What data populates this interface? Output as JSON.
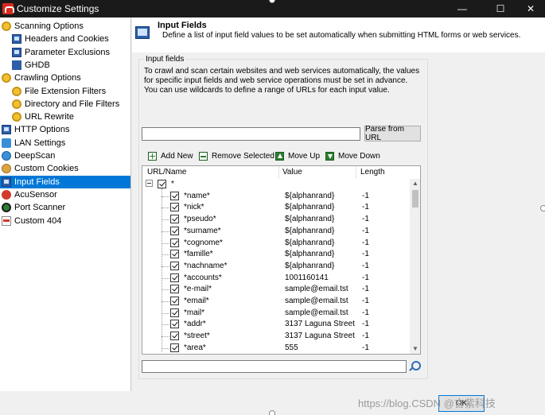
{
  "window": {
    "title": "Customize Settings",
    "minimize": "—",
    "maximize": "☐",
    "close": "✕"
  },
  "tree": [
    {
      "label": "Scanning Options",
      "icon": "gear-icon",
      "level": 0,
      "selected": false
    },
    {
      "label": "Headers and Cookies",
      "icon": "monitor-icon",
      "level": 1,
      "selected": false
    },
    {
      "label": "Parameter Exclusions",
      "icon": "monitor-icon",
      "level": 1,
      "selected": false
    },
    {
      "label": "GHDB",
      "icon": "ghdb-icon",
      "level": 1,
      "selected": false
    },
    {
      "label": "Crawling Options",
      "icon": "gear-icon",
      "level": 0,
      "selected": false
    },
    {
      "label": "File Extension Filters",
      "icon": "gear-icon",
      "level": 1,
      "selected": false
    },
    {
      "label": "Directory and File Filters",
      "icon": "gear-icon",
      "level": 1,
      "selected": false
    },
    {
      "label": "URL Rewrite",
      "icon": "gear-icon",
      "level": 1,
      "selected": false
    },
    {
      "label": "HTTP Options",
      "icon": "monitor-icon",
      "level": 0,
      "selected": false
    },
    {
      "label": "LAN Settings",
      "icon": "lan-icon",
      "level": 0,
      "selected": false
    },
    {
      "label": "DeepScan",
      "icon": "globe-icon",
      "level": 0,
      "selected": false
    },
    {
      "label": "Custom Cookies",
      "icon": "cookie-icon",
      "level": 0,
      "selected": false
    },
    {
      "label": "Input Fields",
      "icon": "monitor-icon",
      "level": 0,
      "selected": true
    },
    {
      "label": "AcuSensor",
      "icon": "acusensor-icon",
      "level": 0,
      "selected": false
    },
    {
      "label": "Port Scanner",
      "icon": "port-scanner-icon",
      "level": 0,
      "selected": false
    },
    {
      "label": "Custom 404",
      "icon": "page-404-icon",
      "level": 0,
      "selected": false
    }
  ],
  "header": {
    "title": "Input Fields",
    "description": "Define a list of input field values to be set automatically when submitting HTML forms or web services."
  },
  "group": {
    "label": "Input fields",
    "description": "To crawl and scan certain websites and web services automatically, the values for specific input fields and web service operations must be set in advance. You can use wildcards to define a range of URLs for each input value."
  },
  "url_input": {
    "value": ""
  },
  "parse_button": "Parse from URL",
  "toolbar": {
    "add": "Add New",
    "remove": "Remove Selected",
    "up": "Move Up",
    "down": "Move Down"
  },
  "list": {
    "columns": [
      "URL/Name",
      "Value",
      "Length"
    ],
    "root": {
      "label": "*",
      "checked": true
    },
    "rows": [
      {
        "name": "*name*",
        "value": "${alphanrand}",
        "length": "-1",
        "checked": true
      },
      {
        "name": "*nick*",
        "value": "${alphanrand}",
        "length": "-1",
        "checked": true
      },
      {
        "name": "*pseudo*",
        "value": "${alphanrand}",
        "length": "-1",
        "checked": true
      },
      {
        "name": "*surname*",
        "value": "${alphanrand}",
        "length": "-1",
        "checked": true
      },
      {
        "name": "*cognome*",
        "value": "${alphanrand}",
        "length": "-1",
        "checked": true
      },
      {
        "name": "*famille*",
        "value": "${alphanrand}",
        "length": "-1",
        "checked": true
      },
      {
        "name": "*nachname*",
        "value": "${alphanrand}",
        "length": "-1",
        "checked": true
      },
      {
        "name": "*accounts*",
        "value": "1001160141",
        "length": "-1",
        "checked": true
      },
      {
        "name": "*e-mail*",
        "value": "sample@email.tst",
        "length": "-1",
        "checked": true
      },
      {
        "name": "*email*",
        "value": "sample@email.tst",
        "length": "-1",
        "checked": true
      },
      {
        "name": "*mail*",
        "value": "sample@email.tst",
        "length": "-1",
        "checked": true
      },
      {
        "name": "*addr*",
        "value": "3137 Laguna Street",
        "length": "-1",
        "checked": true
      },
      {
        "name": "*street*",
        "value": "3137 Laguna Street",
        "length": "-1",
        "checked": true
      },
      {
        "name": "*area*",
        "value": "555",
        "length": "-1",
        "checked": true
      }
    ]
  },
  "search": {
    "value": ""
  },
  "footer": {
    "ok": "OK",
    "watermark": "https://blog.CSDN @言紫科技"
  },
  "colors": {
    "selection": "#0078d7",
    "titlebar": "#1a1a1a"
  }
}
